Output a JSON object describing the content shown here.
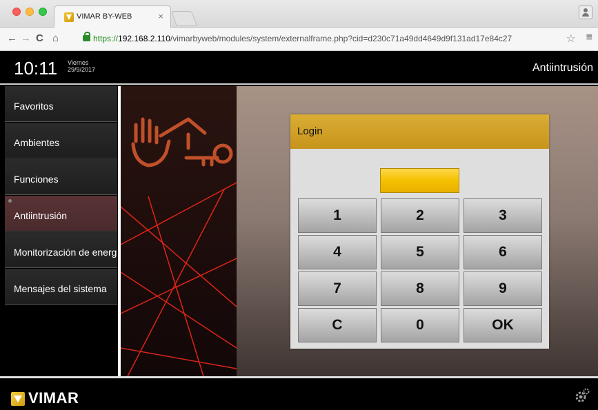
{
  "browser": {
    "tab_title": "VIMAR BY-WEB",
    "tab_close": "×",
    "url_scheme": "https://",
    "url_host": "192.168.2.110",
    "url_path": "/vimarbyweb/modules/system/externalframe.php?cid=d230c71a49dd4649d9f131ad17e84c27",
    "icons": [
      "back-icon",
      "forward-icon",
      "reload-icon",
      "home-icon",
      "lock-icon",
      "star-icon",
      "menu-icon",
      "profile-icon"
    ]
  },
  "header": {
    "time": "10:11",
    "weekday": "Viernes",
    "date": "29/9/2017",
    "section_title": "Antiintrusión"
  },
  "sidebar": {
    "items": [
      {
        "label": "Favoritos",
        "active": false
      },
      {
        "label": "Ambientes",
        "active": false
      },
      {
        "label": "Funciones",
        "active": false
      },
      {
        "label": "Antiintrusión",
        "active": true
      },
      {
        "label": "Monitorización de energía",
        "active": false
      },
      {
        "label": "Mensajes del sistema",
        "active": false
      }
    ]
  },
  "login": {
    "title": "Login",
    "pin_value": "",
    "keys": [
      "1",
      "2",
      "3",
      "4",
      "5",
      "6",
      "7",
      "8",
      "9",
      "C",
      "0",
      "OK"
    ]
  },
  "footer": {
    "brand": "VIMAR"
  },
  "colors": {
    "accent_gold": "#d4a22a",
    "pin_yellow": "#f5c000",
    "active_nav": "#4a2b2d"
  }
}
